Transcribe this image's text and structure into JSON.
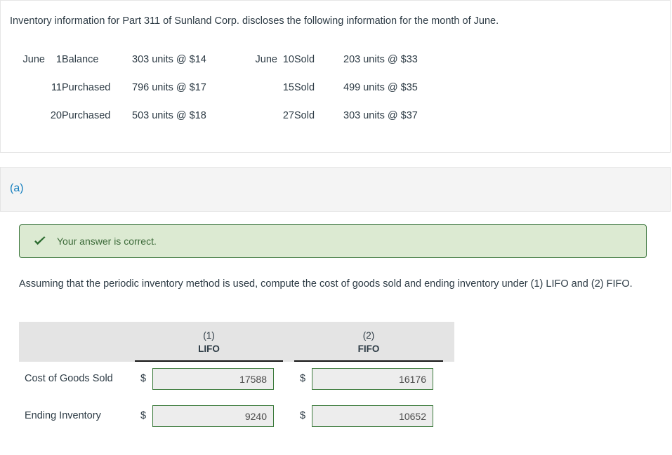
{
  "problem": {
    "intro": "Inventory information for Part 311 of Sunland Corp. discloses the following information for the month of June.",
    "rows": [
      {
        "month": "June",
        "day": "1",
        "action": "Balance",
        "units": "303 units @ $14",
        "month2": "June",
        "day2": "10",
        "action2": "Sold",
        "units2": "203 units @ $33"
      },
      {
        "month": "",
        "day": "11",
        "action": "Purchased",
        "units": "796 units @ $17",
        "month2": "",
        "day2": "15",
        "action2": "Sold",
        "units2": "499 units @ $35"
      },
      {
        "month": "",
        "day": "20",
        "action": "Purchased",
        "units": "503 units @ $18",
        "month2": "",
        "day2": "27",
        "action2": "Sold",
        "units2": "303 units @ $37"
      }
    ]
  },
  "section": {
    "label": "(a)"
  },
  "feedback": {
    "icon": "check-icon",
    "text": "Your answer is correct.",
    "background_color": "#dcead2",
    "border_color": "#3c763d",
    "text_color": "#3c6a39"
  },
  "prompt": {
    "text": "Assuming that the periodic inventory method is used, compute the cost of goods sold and ending inventory under (1) LIFO and (2) FIFO."
  },
  "answer_table": {
    "columns": [
      {
        "number": "(1)",
        "name": "LIFO"
      },
      {
        "number": "(2)",
        "name": "FIFO"
      }
    ],
    "currency_symbol": "$",
    "rows": [
      {
        "label": "Cost of Goods Sold",
        "lifo_value": "17588",
        "fifo_value": "16176"
      },
      {
        "label": "Ending Inventory",
        "lifo_value": "9240",
        "fifo_value": "10652"
      }
    ],
    "input_border_color": "#3b7a3b",
    "input_background_color": "#ededed",
    "header_background_color": "#e4e4e4"
  }
}
